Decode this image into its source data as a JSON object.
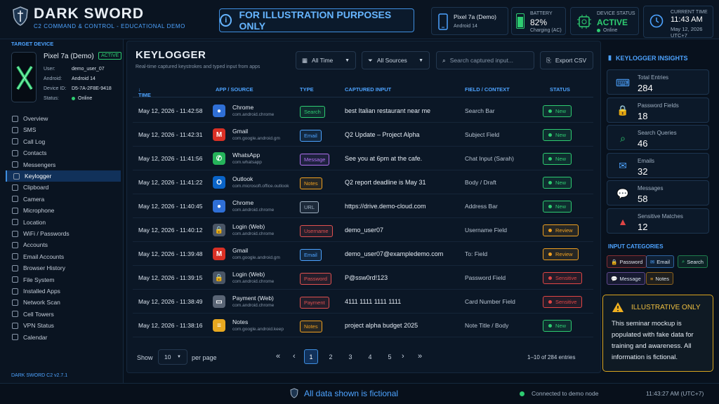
{
  "app": {
    "name": "DARK SWORD",
    "subtitle": "C2 COMMAND & CONTROL - EDUCATIONAL DEMO",
    "version": "DARK SWORD C2 v2.7.1"
  },
  "banner": {
    "text": "FOR ILLUSTRATION PURPOSES ONLY"
  },
  "header": {
    "device": {
      "name": "Pixel 7a (Demo)",
      "os": "Android 14"
    },
    "battery": {
      "label": "BATTERY",
      "value": "82%",
      "level": 0.82,
      "state": "Charging (AC)"
    },
    "status": {
      "label": "DEVICE STATUS",
      "value": "ACTIVE",
      "online": "Online"
    },
    "clock": {
      "label": "CURRENT TIME",
      "time": "11:43 AM",
      "date": "May 12, 2026",
      "tz": "UTC+7"
    }
  },
  "target": {
    "heading": "TARGET DEVICE",
    "name": "Pixel 7a (Demo)",
    "badge": "ACTIVE",
    "fields": [
      {
        "k": "User:",
        "v": "demo_user_07"
      },
      {
        "k": "Android:",
        "v": "Android 14"
      },
      {
        "k": "Device ID:",
        "v": "D5-7A-2F8E-9418"
      },
      {
        "k": "Status:",
        "v": "Online"
      }
    ]
  },
  "nav": [
    "Overview",
    "SMS",
    "Call Log",
    "Contacts",
    "Messengers",
    "Keylogger",
    "Clipboard",
    "Camera",
    "Microphone",
    "Location",
    "WiFi / Passwords",
    "Accounts",
    "Email Accounts",
    "Browser History",
    "File System",
    "Installed Apps",
    "Network Scan",
    "Cell Towers",
    "VPN Status",
    "Calendar"
  ],
  "main": {
    "title": "KEYLOGGER",
    "subtitle": "Real-time captured keystrokes and typed input from apps",
    "filter_time": "All Time",
    "filter_source": "All Sources",
    "search_placeholder": "Search captured input...",
    "export": "Export CSV",
    "columns": [
      "TIME",
      "APP / SOURCE",
      "TYPE",
      "CAPTURED INPUT",
      "FIELD / CONTEXT",
      "STATUS"
    ],
    "rows": [
      {
        "time": "May 12, 2026 - 11:42:58",
        "app": "Chrome",
        "pkg": "com.android.chrome",
        "icon": "chrome-icon",
        "type": "Search",
        "input": "best Italian restaurant near me",
        "field": "Search Bar",
        "status": "New"
      },
      {
        "time": "May 12, 2026 - 11:42:31",
        "app": "Gmail",
        "pkg": "com.google.android.gm",
        "icon": "gmail-icon",
        "type": "Email",
        "input": "Q2 Update – Project Alpha",
        "field": "Subject Field",
        "status": "New"
      },
      {
        "time": "May 12, 2026 - 11:41:56",
        "app": "WhatsApp",
        "pkg": "com.whatsapp",
        "icon": "whatsapp-icon",
        "type": "Message",
        "input": "See you at 6pm at the cafe.",
        "field": "Chat Input (Sarah)",
        "status": "New"
      },
      {
        "time": "May 12, 2026 - 11:41:22",
        "app": "Outlook",
        "pkg": "com.microsoft.office.outlook",
        "icon": "outlook-icon",
        "type": "Notes",
        "input": "Q2 report deadline is May 31",
        "field": "Body / Draft",
        "status": "New"
      },
      {
        "time": "May 12, 2026 - 11:40:45",
        "app": "Chrome",
        "pkg": "com.android.chrome",
        "icon": "chrome-icon",
        "type": "URL",
        "input": "https://drive.demo-cloud.com",
        "field": "Address Bar",
        "status": "New"
      },
      {
        "time": "May 12, 2026 - 11:40:12",
        "app": "Login (Web)",
        "pkg": "com.android.chrome",
        "icon": "lock-icon",
        "type": "Username",
        "input": "demo_user07",
        "field": "Username Field",
        "status": "Review"
      },
      {
        "time": "May 12, 2026 - 11:39:48",
        "app": "Gmail",
        "pkg": "com.google.android.gm",
        "icon": "gmail-icon",
        "type": "Email",
        "input": "demo_user07@exampledemo.com",
        "field": "To: Field",
        "status": "Review"
      },
      {
        "time": "May 12, 2026 - 11:39:15",
        "app": "Login (Web)",
        "pkg": "com.android.chrome",
        "icon": "lock-icon",
        "type": "Password",
        "input": "P@ssw0rd!123",
        "field": "Password Field",
        "status": "Sensitive"
      },
      {
        "time": "May 12, 2026 - 11:38:49",
        "app": "Payment (Web)",
        "pkg": "com.android.chrome",
        "icon": "card-icon",
        "type": "Payment",
        "input": "4111 1111 1111 1111",
        "field": "Card Number Field",
        "status": "Sensitive"
      },
      {
        "time": "May 12, 2026 - 11:38:16",
        "app": "Notes",
        "pkg": "com.google.android.keep",
        "icon": "notes-icon",
        "type": "Notes",
        "input": "project alpha budget 2025",
        "field": "Note Title / Body",
        "status": "New"
      }
    ],
    "show_label": "Show",
    "per_page": "10",
    "per_page_label": "per page",
    "pages": [
      "1",
      "2",
      "3",
      "4",
      "5"
    ],
    "entries": "1–10 of 284 entries"
  },
  "insights": {
    "title": "KEYLOGGER INSIGHTS",
    "stats": [
      {
        "label": "Total Entries",
        "value": "284"
      },
      {
        "label": "Password Fields",
        "value": "18"
      },
      {
        "label": "Search Queries",
        "value": "46"
      },
      {
        "label": "Emails",
        "value": "32"
      },
      {
        "label": "Messages",
        "value": "58"
      },
      {
        "label": "Sensitive Matches",
        "value": "12"
      }
    ],
    "cat_title": "INPUT CATEGORIES",
    "categories": [
      "Password",
      "Email",
      "Search",
      "Message",
      "Notes"
    ]
  },
  "notice": {
    "title": "ILLUSTRATIVE ONLY",
    "body": "This seminar mockup is populated with fake data for training and awareness. All information is fictional."
  },
  "footer": {
    "center": "All data shown is fictional",
    "conn": "Connected to demo node",
    "time": "11:43:27 AM (UTC+7)"
  },
  "colors": {
    "accent": "#3f8fe0",
    "green": "#2ecc71",
    "orange": "#f0a020",
    "red": "#e04545",
    "purple": "#a070e0"
  }
}
